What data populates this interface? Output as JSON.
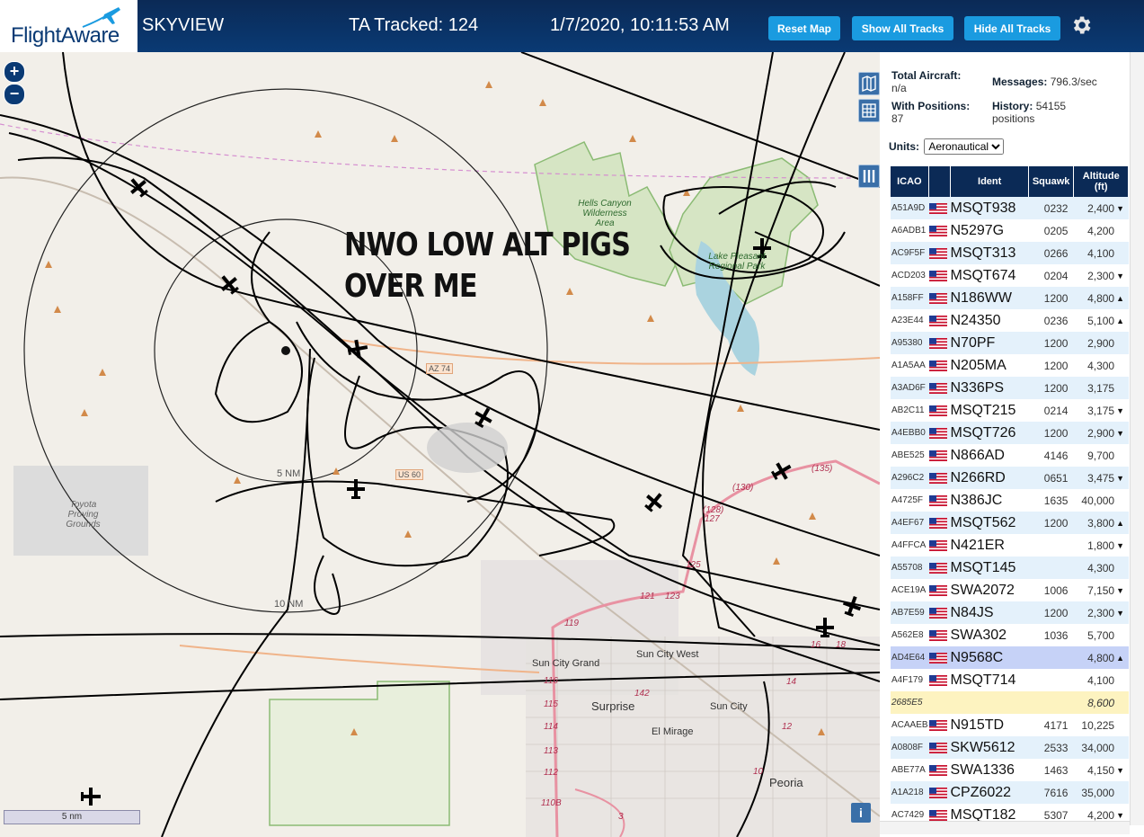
{
  "header": {
    "logo_text": "FlightAware",
    "app_title": "SKYVIEW",
    "tracked": "TA Tracked: 124",
    "datetime": "1/7/2020, 10:11:53 AM",
    "buttons": {
      "reset": "Reset Map",
      "show_all": "Show All Tracks",
      "hide_all": "Hide All Tracks"
    },
    "colors": {
      "bar": "#0b2a56",
      "button": "#1a9be0"
    }
  },
  "map": {
    "zoom_in": "+",
    "zoom_out": "−",
    "annotation_line1": "NWO LOW ALT PIGS",
    "annotation_line2": "OVER ME",
    "range_rings": [
      "5 NM",
      "10 NM"
    ],
    "labels": {
      "hells_canyon": "Hells Canyon Wilderness Area",
      "lake_pleasant": "Lake Pleasant Regional Park",
      "toyota": "Toyota Proving Grounds",
      "az74": "AZ 74",
      "us60": "US 60",
      "sun_city_grand": "Sun City Grand",
      "sun_city_west": "Sun City West",
      "surprise": "Surprise",
      "el_mirage": "El Mirage",
      "sun_city": "Sun City",
      "peoria": "Peoria"
    },
    "road_numbers": [
      "(135)",
      "(130)",
      "(128)",
      "127",
      "125",
      "123",
      "121",
      "119",
      "116",
      "115",
      "114",
      "113",
      "112",
      "110B",
      "142",
      "14",
      "12",
      "10",
      "18",
      "16",
      "3"
    ],
    "scale": "5 nm",
    "info_button": "i",
    "colors": {
      "land": "#f2efe9",
      "park": "#c9dcb0",
      "water": "#aad3df",
      "track": "#000000",
      "highway": "#e892a2"
    }
  },
  "panel": {
    "total_label": "Total Aircraft:",
    "total_value": "n/a",
    "messages_label": "Messages:",
    "messages_value": "796.3/sec",
    "positions_label": "With Positions:",
    "positions_value": "87",
    "history_label": "History:",
    "history_value": "54155",
    "history_unit": "positions",
    "units_label": "Units:",
    "units_value": "Aeronautical",
    "columns": {
      "icao": "ICAO",
      "ident": "Ident",
      "squawk": "Squawk",
      "alt1": "Altitude",
      "alt2": "(ft)"
    },
    "rows": [
      {
        "icao": "A51A9D",
        "flag": true,
        "ident": "MSQT938",
        "squawk": "0232",
        "alt": "2,400",
        "dir": "▼"
      },
      {
        "icao": "A6ADB1",
        "flag": true,
        "ident": "N5297G",
        "squawk": "0205",
        "alt": "4,200",
        "dir": ""
      },
      {
        "icao": "AC9F5F",
        "flag": true,
        "ident": "MSQT313",
        "squawk": "0266",
        "alt": "4,100",
        "dir": ""
      },
      {
        "icao": "ACD203",
        "flag": true,
        "ident": "MSQT674",
        "squawk": "0204",
        "alt": "2,300",
        "dir": "▼"
      },
      {
        "icao": "A158FF",
        "flag": true,
        "ident": "N186WW",
        "squawk": "1200",
        "alt": "4,800",
        "dir": "▲"
      },
      {
        "icao": "A23E44",
        "flag": true,
        "ident": "N24350",
        "squawk": "0236",
        "alt": "5,100",
        "dir": "▲"
      },
      {
        "icao": "A95380",
        "flag": true,
        "ident": "N70PF",
        "squawk": "1200",
        "alt": "2,900",
        "dir": ""
      },
      {
        "icao": "A1A5AA",
        "flag": true,
        "ident": "N205MA",
        "squawk": "1200",
        "alt": "4,300",
        "dir": ""
      },
      {
        "icao": "A3AD6F",
        "flag": true,
        "ident": "N336PS",
        "squawk": "1200",
        "alt": "3,175",
        "dir": ""
      },
      {
        "icao": "AB2C11",
        "flag": true,
        "ident": "MSQT215",
        "squawk": "0214",
        "alt": "3,175",
        "dir": "▼"
      },
      {
        "icao": "A4EBB0",
        "flag": true,
        "ident": "MSQT726",
        "squawk": "1200",
        "alt": "2,900",
        "dir": "▼"
      },
      {
        "icao": "ABE525",
        "flag": true,
        "ident": "N866AD",
        "squawk": "4146",
        "alt": "9,700",
        "dir": ""
      },
      {
        "icao": "A296C2",
        "flag": true,
        "ident": "N266RD",
        "squawk": "0651",
        "alt": "3,475",
        "dir": "▼"
      },
      {
        "icao": "A4725F",
        "flag": true,
        "ident": "N386JC",
        "squawk": "1635",
        "alt": "40,000",
        "dir": ""
      },
      {
        "icao": "A4EF67",
        "flag": true,
        "ident": "MSQT562",
        "squawk": "1200",
        "alt": "3,800",
        "dir": "▲"
      },
      {
        "icao": "A4FFCA",
        "flag": true,
        "ident": "N421ER",
        "squawk": "",
        "alt": "1,800",
        "dir": "▼"
      },
      {
        "icao": "A55708",
        "flag": true,
        "ident": "MSQT145",
        "squawk": "",
        "alt": "4,300",
        "dir": ""
      },
      {
        "icao": "ACE19A",
        "flag": true,
        "ident": "SWA2072",
        "squawk": "1006",
        "alt": "7,150",
        "dir": "▼"
      },
      {
        "icao": "AB7E59",
        "flag": true,
        "ident": "N84JS",
        "squawk": "1200",
        "alt": "2,300",
        "dir": "▼"
      },
      {
        "icao": "A562E8",
        "flag": true,
        "ident": "SWA302",
        "squawk": "1036",
        "alt": "5,700",
        "dir": ""
      },
      {
        "icao": "AD4E64",
        "flag": true,
        "ident": "N9568C",
        "squawk": "",
        "alt": "4,800",
        "dir": "▲",
        "selected": true
      },
      {
        "icao": "A4F179",
        "flag": true,
        "ident": "MSQT714",
        "squawk": "",
        "alt": "4,100",
        "dir": ""
      },
      {
        "icao": "2685E5",
        "flag": false,
        "ident": "",
        "squawk": "",
        "alt": "8,600",
        "dir": "",
        "yellow": true
      },
      {
        "icao": "ACAAEB",
        "flag": true,
        "ident": "N915TD",
        "squawk": "4171",
        "alt": "10,225",
        "dir": ""
      },
      {
        "icao": "A0808F",
        "flag": true,
        "ident": "SKW5612",
        "squawk": "2533",
        "alt": "34,000",
        "dir": ""
      },
      {
        "icao": "ABE77A",
        "flag": true,
        "ident": "SWA1336",
        "squawk": "1463",
        "alt": "4,150",
        "dir": "▼"
      },
      {
        "icao": "A1A218",
        "flag": true,
        "ident": "CPZ6022",
        "squawk": "7616",
        "alt": "35,000",
        "dir": ""
      },
      {
        "icao": "AC7429",
        "flag": true,
        "ident": "MSQT182",
        "squawk": "5307",
        "alt": "4,200",
        "dir": "▼"
      }
    ]
  }
}
